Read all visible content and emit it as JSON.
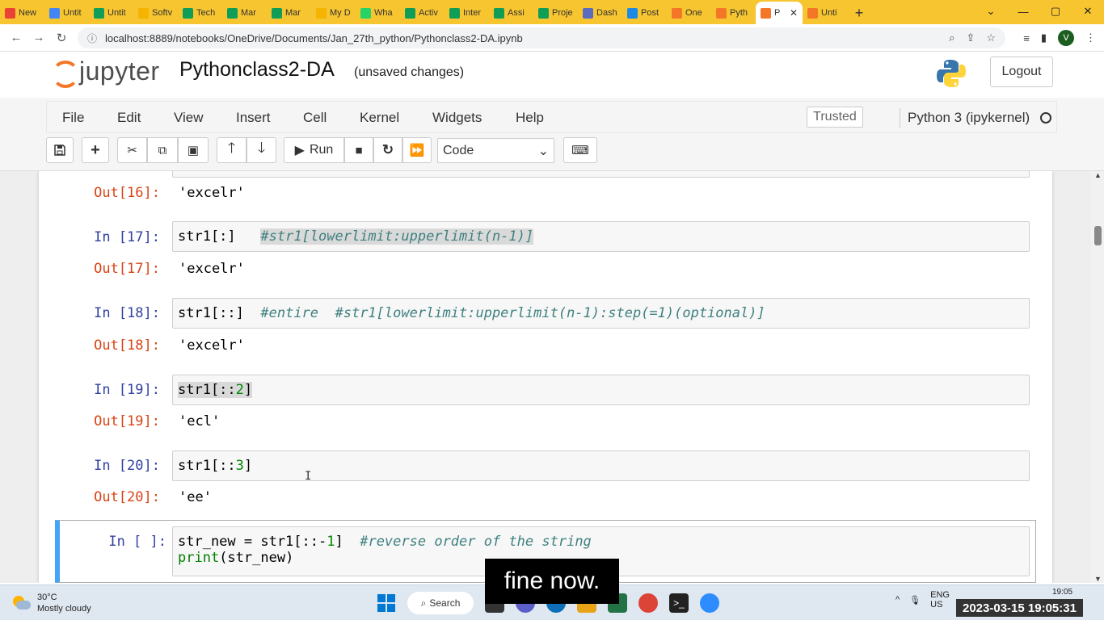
{
  "browser": {
    "tabs": [
      {
        "label": "New",
        "icon": "gmail-icon",
        "color": "#ea4335"
      },
      {
        "label": "Untit",
        "icon": "docs-icon",
        "color": "#4285f4"
      },
      {
        "label": "Untit",
        "icon": "sheets-icon",
        "color": "#0f9d58"
      },
      {
        "label": "Softv",
        "icon": "drive-icon",
        "color": "#f4b400"
      },
      {
        "label": "Tech",
        "icon": "sheets-icon",
        "color": "#0f9d58"
      },
      {
        "label": "Mar",
        "icon": "sheets-icon",
        "color": "#0f9d58"
      },
      {
        "label": "Mar",
        "icon": "sheets-icon",
        "color": "#0f9d58"
      },
      {
        "label": "My D",
        "icon": "drive-icon",
        "color": "#f4b400"
      },
      {
        "label": "Wha",
        "icon": "whatsapp-icon",
        "color": "#25d366"
      },
      {
        "label": "Activ",
        "icon": "sheets-icon",
        "color": "#0f9d58"
      },
      {
        "label": "Inter",
        "icon": "sheets-icon",
        "color": "#0f9d58"
      },
      {
        "label": "Assi",
        "icon": "sheets-icon",
        "color": "#0f9d58"
      },
      {
        "label": "Proje",
        "icon": "sheets-icon",
        "color": "#0f9d58"
      },
      {
        "label": "Dash",
        "icon": "dashboard-icon",
        "color": "#5c6bc0"
      },
      {
        "label": "Post",
        "icon": "zoho-icon",
        "color": "#1e88e5"
      },
      {
        "label": "One",
        "icon": "onedrive-icon",
        "color": "#f37726"
      },
      {
        "label": "Pyth",
        "icon": "jupyter-icon",
        "color": "#f37726"
      },
      {
        "label": "P",
        "icon": "jupyter-icon",
        "color": "#f37726",
        "active": true
      },
      {
        "label": "Unti",
        "icon": "jupyter-icon",
        "color": "#f37726"
      }
    ],
    "url": "localhost:8889/notebooks/OneDrive/Documents/Jan_27th_python/Pythonclass2-DA.ipynb",
    "profile_initial": "V"
  },
  "jupyter": {
    "logo_text": "jupyter",
    "notebook_title": "Pythonclass2-DA",
    "save_status": "(unsaved changes)",
    "logout_label": "Logout",
    "menu": [
      "File",
      "Edit",
      "View",
      "Insert",
      "Cell",
      "Kernel",
      "Widgets",
      "Help"
    ],
    "trusted_label": "Trusted",
    "kernel_name": "Python 3 (ipykernel)",
    "run_label": "Run",
    "cell_type": "Code"
  },
  "cells": [
    {
      "out_prompt": "Out[16]:",
      "output": "'excelr'"
    },
    {
      "in_prompt": "In [17]:",
      "code": "str1[:]",
      "comment": "#str1[lowerlimit:upperlimit(n-1)]",
      "out_prompt": "Out[17]:",
      "output": "'excelr'"
    },
    {
      "in_prompt": "In [18]:",
      "code": "str1[::]",
      "comment": "#entire  #str1[lowerlimit:upperlimit(n-1):step(=1)(optional)]",
      "out_prompt": "Out[18]:",
      "output": "'excelr'"
    },
    {
      "in_prompt": "In [19]:",
      "code_pre": "str1[::",
      "code_num": "2",
      "code_post": "]",
      "out_prompt": "Out[19]:",
      "output": "'ecl'"
    },
    {
      "in_prompt": "In [20]:",
      "code_pre": "str1[::",
      "code_num": "3",
      "code_post": "]",
      "out_prompt": "Out[20]:",
      "output": "'ee'"
    },
    {
      "in_prompt": "In [ ]:",
      "line1_pre": "str_new = str1[::-",
      "line1_num": "1",
      "line1_post": "]",
      "line1_comment": "#reverse order of the string",
      "line2_kw": "print",
      "line2_rest": "(str_new)"
    }
  ],
  "caption": "fine now.",
  "taskbar": {
    "temperature": "30°C",
    "weather": "Mostly cloudy",
    "search_label": "Search",
    "lang_top": "ENG",
    "lang_bottom": "US",
    "timestamp": "2023-03-15 19:05:31",
    "clock_small": "19:05"
  }
}
